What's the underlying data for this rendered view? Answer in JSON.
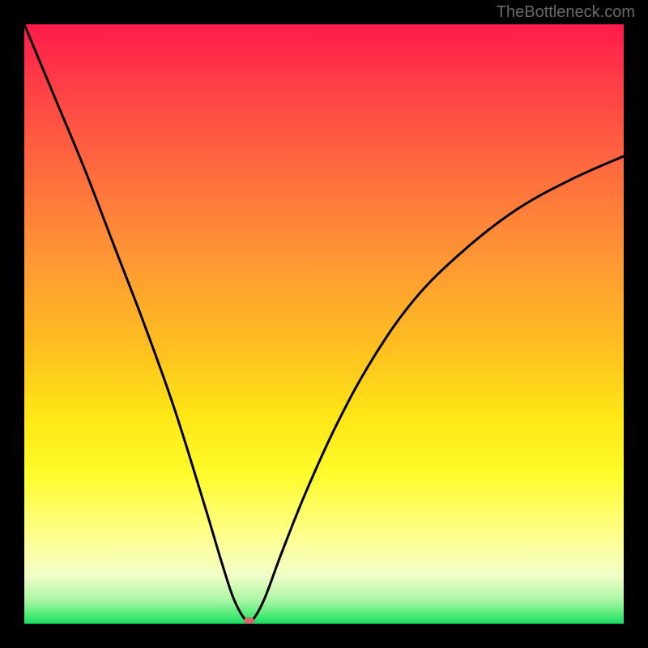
{
  "watermark": "TheBottleneck.com",
  "chart_data": {
    "type": "line",
    "title": "",
    "xlabel": "",
    "ylabel": "",
    "xlim": [
      0,
      100
    ],
    "ylim": [
      0,
      100
    ],
    "grid": false,
    "background_gradient": {
      "orientation": "vertical",
      "stops": [
        {
          "pos": 0.0,
          "color": "#ff1a4a"
        },
        {
          "pos": 0.25,
          "color": "#ff6d3e"
        },
        {
          "pos": 0.55,
          "color": "#ffc21f"
        },
        {
          "pos": 0.75,
          "color": "#fffb2a"
        },
        {
          "pos": 0.92,
          "color": "#f1ffc8"
        },
        {
          "pos": 1.0,
          "color": "#18dc62"
        }
      ]
    },
    "series": [
      {
        "name": "bottleneck-curve",
        "color": "#000000",
        "x": [
          0,
          5,
          10,
          15,
          20,
          25,
          30,
          33,
          35,
          37,
          38,
          40,
          43,
          47,
          52,
          58,
          65,
          73,
          82,
          91,
          100
        ],
        "y": [
          100,
          88,
          76,
          63,
          50,
          36,
          20,
          10,
          4,
          0.5,
          0.5,
          4,
          12,
          22,
          33,
          44,
          54,
          62,
          69,
          74,
          78
        ]
      }
    ],
    "marker": {
      "name": "optimum-point",
      "x": 37.5,
      "y": 0.5,
      "color": "#d06a6a",
      "rx": 7,
      "ry": 4
    }
  }
}
